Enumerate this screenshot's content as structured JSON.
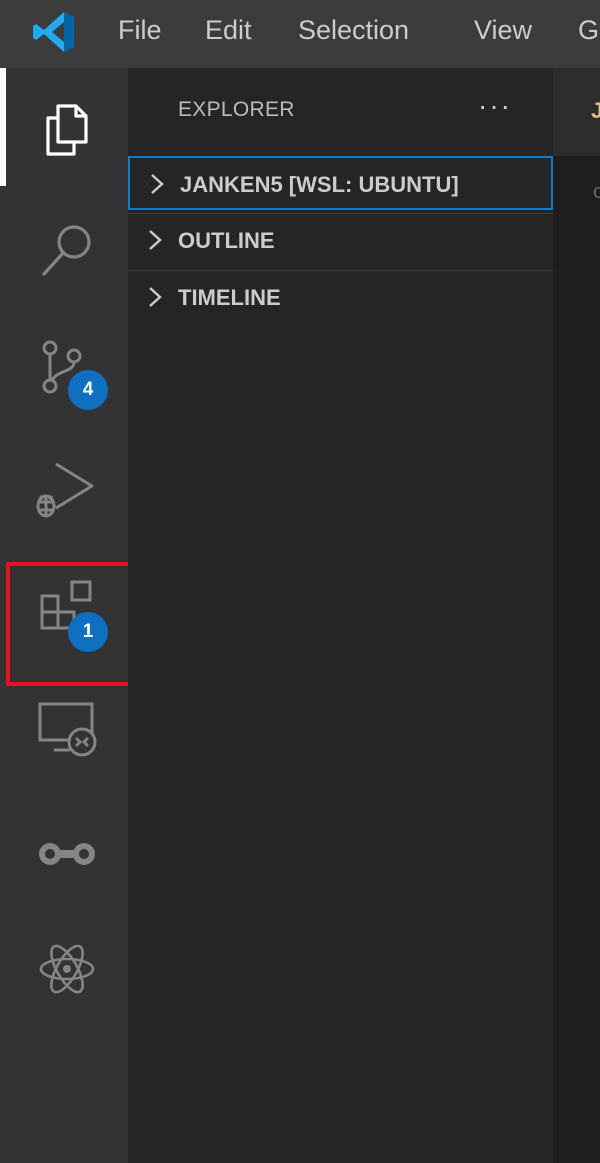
{
  "menu": {
    "file": "File",
    "edit": "Edit",
    "selection": "Selection",
    "view": "View",
    "go": "G"
  },
  "activitybar": {
    "items": [
      {
        "name": "explorer-icon",
        "active": true
      },
      {
        "name": "search-icon"
      },
      {
        "name": "source-control-icon",
        "badge": "4"
      },
      {
        "name": "run-debug-icon"
      },
      {
        "name": "extensions-icon",
        "badge": "1",
        "highlighted": true
      },
      {
        "name": "remote-explorer-icon"
      },
      {
        "name": "live-share-icon"
      },
      {
        "name": "react-icon"
      }
    ]
  },
  "sidebar": {
    "title": "EXPLORER",
    "more": "···",
    "sections": [
      {
        "label": "JANKEN5 [WSL: UBUNTU]"
      },
      {
        "label": "OUTLINE"
      },
      {
        "label": "TIMELINE"
      }
    ]
  },
  "editor": {
    "tab_label": "J",
    "glyph": "c"
  },
  "colors": {
    "activitybar_bg": "#333333",
    "sidebar_bg": "#252526",
    "badge": "#0e70c0",
    "highlight": "#e81123",
    "focus_border": "#007fd4"
  }
}
